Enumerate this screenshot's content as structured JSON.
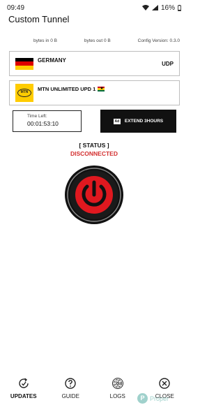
{
  "status_bar": {
    "time": "09:49",
    "battery": "16%"
  },
  "app": {
    "title": "Custom Tunnel"
  },
  "stats": {
    "bytes_in": "bytes in 0 B",
    "bytes_out": "bytes out 0 B",
    "config_version": "Config Version: 0.3.0"
  },
  "server": {
    "name": "GERMANY",
    "protocol": "UDP",
    "flag_colors": [
      "#000000",
      "#dd0000",
      "#ffce00"
    ]
  },
  "network": {
    "logo_text": "MTN",
    "name": "MTN UNLIMITED UPD 1",
    "logo_color": "#ffcc00",
    "flag_colors": [
      "#ce1126",
      "#fcd116",
      "#006b3f"
    ]
  },
  "timer": {
    "label": "Time Left:",
    "value": "00:01:53:10"
  },
  "extend": {
    "ad_badge": "Ad",
    "label": "EXTEND 3HOURS"
  },
  "connection": {
    "heading": "[ STATUS ]",
    "state": "DISCONNECTED",
    "state_color": "#d32f2f",
    "power_color": "#e0181f"
  },
  "nav": {
    "items": [
      {
        "label": "UPDATES",
        "icon": "refresh-clock-icon",
        "active": true
      },
      {
        "label": "GUIDE",
        "icon": "help-icon",
        "active": false
      },
      {
        "label": "LOGS",
        "icon": "fingerprint-icon",
        "active": false
      },
      {
        "label": "CLOSE",
        "icon": "close-circle-icon",
        "active": false
      }
    ]
  },
  "watermark": {
    "symbol": "P",
    "text": "Proper"
  }
}
